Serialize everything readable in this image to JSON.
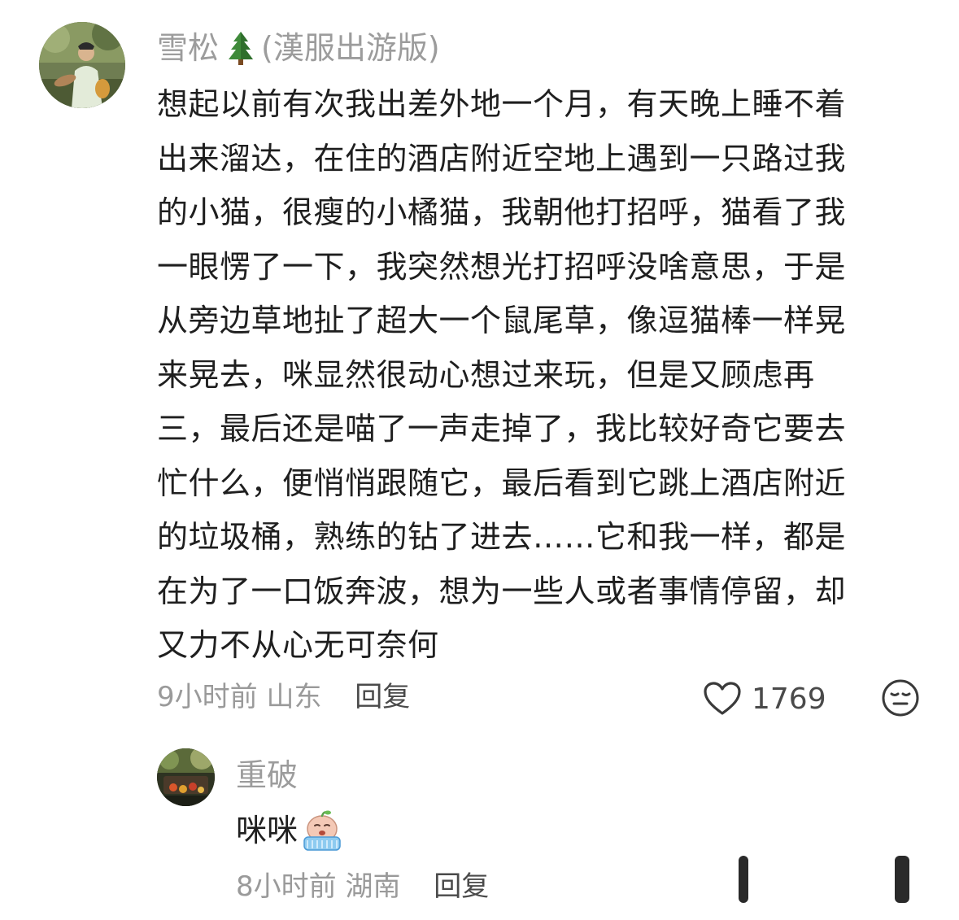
{
  "main_comment": {
    "username": "雪松",
    "username_icon": "pine-tree-emoji",
    "username_suffix": "(漢服出游版)",
    "body_lines": [
      "想起以前有次我出差外地一个月，有天晚上睡不着",
      "出来溜达，在住的酒店附近空地上遇到一只路过我",
      "的小猫，很瘦的小橘猫，我朝他打招呼，猫看了我",
      "一眼愣了一下，我突然想光打招呼没啥意思，于是",
      "从旁边草地扯了超大一个鼠尾草，像逗猫棒一样晃",
      "来晃去，咪显然很动心想过来玩，但是又顾虑再",
      "三，最后还是喵了一声走掉了，我比较好奇它要去",
      "忙什么，便悄悄跟随它，最后看到它跳上酒店附近",
      "的垃圾桶，熟练的钻了进去……它和我一样，都是",
      "在为了一口饭奔波，想为一些人或者事情停留，却",
      "又力不从心无可奈何"
    ],
    "time": "9小时前",
    "location": "山东",
    "reply_label": "回复",
    "like_count": "1769",
    "like_icon": "heart-outline-icon",
    "dislike_icon": "meh-face-icon"
  },
  "reply_comment": {
    "username": "重破",
    "text": "咪咪",
    "emoji": "crying-face-emoji",
    "time": "8小时前",
    "location": "湖南",
    "reply_label": "回复"
  },
  "colors": {
    "meta_gray": "#9a9a9a",
    "text_dark": "#1f1f1f",
    "username_gray": "#9c9c9c",
    "action_dark": "#4a4a4a"
  }
}
